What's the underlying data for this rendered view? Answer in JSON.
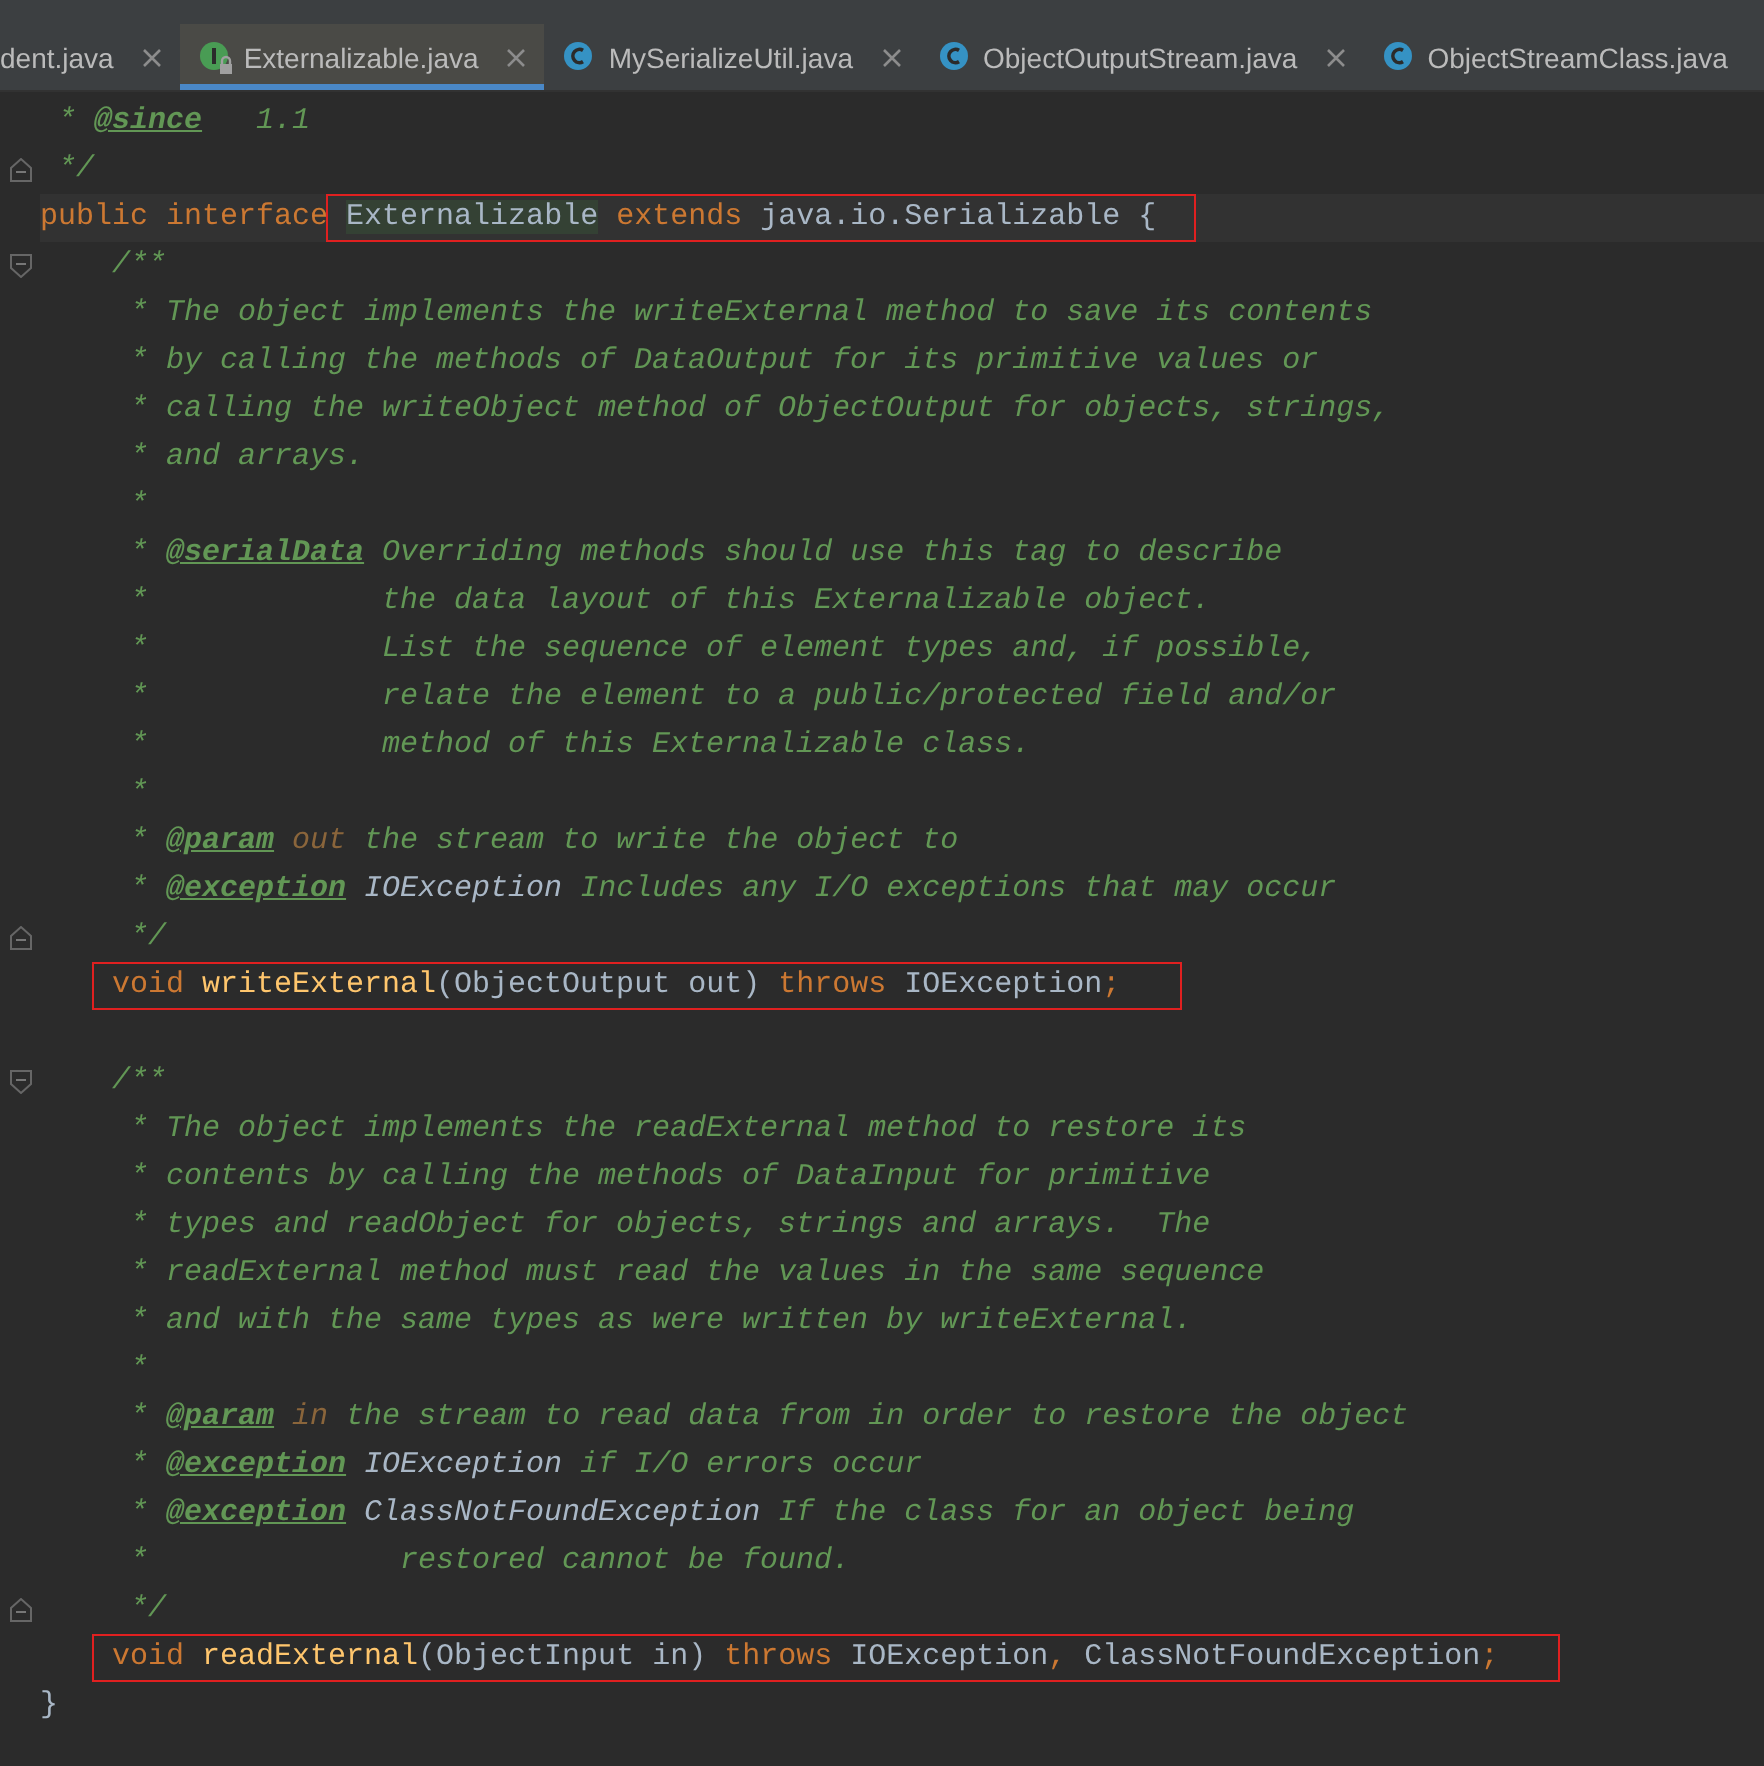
{
  "tabs": [
    {
      "label": "dent.java",
      "kind": "class_partial",
      "selected": false,
      "closable": true
    },
    {
      "label": "Externalizable.java",
      "kind": "interface",
      "selected": true,
      "closable": true
    },
    {
      "label": "MySerializeUtil.java",
      "kind": "class",
      "selected": false,
      "closable": true
    },
    {
      "label": "ObjectOutputStream.java",
      "kind": "class",
      "selected": false,
      "closable": true
    },
    {
      "label": "ObjectStreamClass.java",
      "kind": "class",
      "selected": false,
      "closable": false
    }
  ],
  "editor": {
    "lines": [
      {
        "tokens": [
          {
            "kind": "comment",
            "text": " * "
          },
          {
            "kind": "doctag",
            "text": "@since"
          },
          {
            "kind": "comment",
            "text": "   1.1"
          }
        ]
      },
      {
        "fold_end": true,
        "tokens": [
          {
            "kind": "comment",
            "text": " */"
          }
        ]
      },
      {
        "current": true,
        "tokens": [
          {
            "kind": "keyword",
            "text": "public"
          },
          {
            "kind": "keyword",
            "text": " interface "
          }
        ],
        "framed_tokens": [
          {
            "kind": "usage",
            "text": "Externalizable"
          },
          {
            "kind": "keyword",
            "text": " extends"
          },
          {
            "kind": "plain",
            "text": " java.io.Serializable {"
          }
        ]
      },
      {
        "fold_start": true,
        "tokens": [
          {
            "kind": "comment",
            "text": "    /**"
          }
        ]
      },
      {
        "tokens": [
          {
            "kind": "comment",
            "text": "     * The object implements the writeExternal method to save its contents"
          }
        ]
      },
      {
        "tokens": [
          {
            "kind": "comment",
            "text": "     * by calling the methods of DataOutput for its primitive values or"
          }
        ]
      },
      {
        "tokens": [
          {
            "kind": "comment",
            "text": "     * calling the writeObject method of ObjectOutput for objects, strings,"
          }
        ]
      },
      {
        "tokens": [
          {
            "kind": "comment",
            "text": "     * and arrays."
          }
        ]
      },
      {
        "tokens": [
          {
            "kind": "comment",
            "text": "     *"
          }
        ]
      },
      {
        "tokens": [
          {
            "kind": "comment",
            "text": "     * "
          },
          {
            "kind": "doctag",
            "text": "@serialData"
          },
          {
            "kind": "comment",
            "text": " Overriding methods should use this tag to describe"
          }
        ]
      },
      {
        "tokens": [
          {
            "kind": "comment",
            "text": "     *             the data layout of this Externalizable object."
          }
        ]
      },
      {
        "tokens": [
          {
            "kind": "comment",
            "text": "     *             List the sequence of element types and, if possible,"
          }
        ]
      },
      {
        "tokens": [
          {
            "kind": "comment",
            "text": "     *             relate the element to a public/protected field and/or"
          }
        ]
      },
      {
        "tokens": [
          {
            "kind": "comment",
            "text": "     *             method of this Externalizable class."
          }
        ]
      },
      {
        "tokens": [
          {
            "kind": "comment",
            "text": "     *"
          }
        ]
      },
      {
        "tokens": [
          {
            "kind": "comment",
            "text": "     * "
          },
          {
            "kind": "doctag",
            "text": "@param"
          },
          {
            "kind": "param",
            "text": " out"
          },
          {
            "kind": "comment",
            "text": " the stream to write the object to"
          }
        ]
      },
      {
        "tokens": [
          {
            "kind": "comment",
            "text": "     * "
          },
          {
            "kind": "doctag",
            "text": "@exception"
          },
          {
            "kind": "docref",
            "text": " IOException"
          },
          {
            "kind": "comment",
            "text": " Includes any I/O exceptions that may occur"
          }
        ]
      },
      {
        "fold_end": true,
        "tokens": [
          {
            "kind": "comment",
            "text": "     */"
          }
        ]
      },
      {
        "framed_tokens": [
          {
            "kind": "keyword",
            "text": "void"
          },
          {
            "kind": "method",
            "text": " writeExternal"
          },
          {
            "kind": "plain",
            "text": "(ObjectOutput out) "
          },
          {
            "kind": "keyword",
            "text": "throws"
          },
          {
            "kind": "plain",
            "text": " IOException"
          },
          {
            "kind": "keyword",
            "text": ";"
          }
        ]
      },
      {
        "blank": true
      },
      {
        "fold_start": true,
        "tokens": [
          {
            "kind": "comment",
            "text": "    /**"
          }
        ]
      },
      {
        "tokens": [
          {
            "kind": "comment",
            "text": "     * The object implements the readExternal method to restore its"
          }
        ]
      },
      {
        "tokens": [
          {
            "kind": "comment",
            "text": "     * contents by calling the methods of DataInput for primitive"
          }
        ]
      },
      {
        "tokens": [
          {
            "kind": "comment",
            "text": "     * types and readObject for objects, strings and arrays.  The"
          }
        ]
      },
      {
        "tokens": [
          {
            "kind": "comment",
            "text": "     * readExternal method must read the values in the same sequence"
          }
        ]
      },
      {
        "tokens": [
          {
            "kind": "comment",
            "text": "     * and with the same types as were written by writeExternal."
          }
        ]
      },
      {
        "tokens": [
          {
            "kind": "comment",
            "text": "     *"
          }
        ]
      },
      {
        "tokens": [
          {
            "kind": "comment",
            "text": "     * "
          },
          {
            "kind": "doctag",
            "text": "@param"
          },
          {
            "kind": "param",
            "text": " in"
          },
          {
            "kind": "comment",
            "text": " the stream to read data from in order to restore the object"
          }
        ]
      },
      {
        "tokens": [
          {
            "kind": "comment",
            "text": "     * "
          },
          {
            "kind": "doctag",
            "text": "@exception"
          },
          {
            "kind": "docref",
            "text": " IOException"
          },
          {
            "kind": "comment",
            "text": " if I/O errors occur"
          }
        ]
      },
      {
        "tokens": [
          {
            "kind": "comment",
            "text": "     * "
          },
          {
            "kind": "doctag",
            "text": "@exception"
          },
          {
            "kind": "docref",
            "text": " ClassNotFoundException"
          },
          {
            "kind": "comment",
            "text": " If the class for an object being"
          }
        ]
      },
      {
        "tokens": [
          {
            "kind": "comment",
            "text": "     *              restored cannot be found."
          }
        ]
      },
      {
        "fold_end": true,
        "tokens": [
          {
            "kind": "comment",
            "text": "     */"
          }
        ]
      },
      {
        "framed_tokens": [
          {
            "kind": "keyword",
            "text": "void"
          },
          {
            "kind": "method",
            "text": " readExternal"
          },
          {
            "kind": "plain",
            "text": "(ObjectInput in) "
          },
          {
            "kind": "keyword",
            "text": "throws"
          },
          {
            "kind": "plain",
            "text": " IOException"
          },
          {
            "kind": "keyword",
            "text": ","
          },
          {
            "kind": "plain",
            "text": " ClassNotFoundException"
          },
          {
            "kind": "keyword",
            "text": ";"
          }
        ]
      },
      {
        "tokens": [
          {
            "kind": "plain",
            "text": "}"
          }
        ]
      }
    ]
  }
}
